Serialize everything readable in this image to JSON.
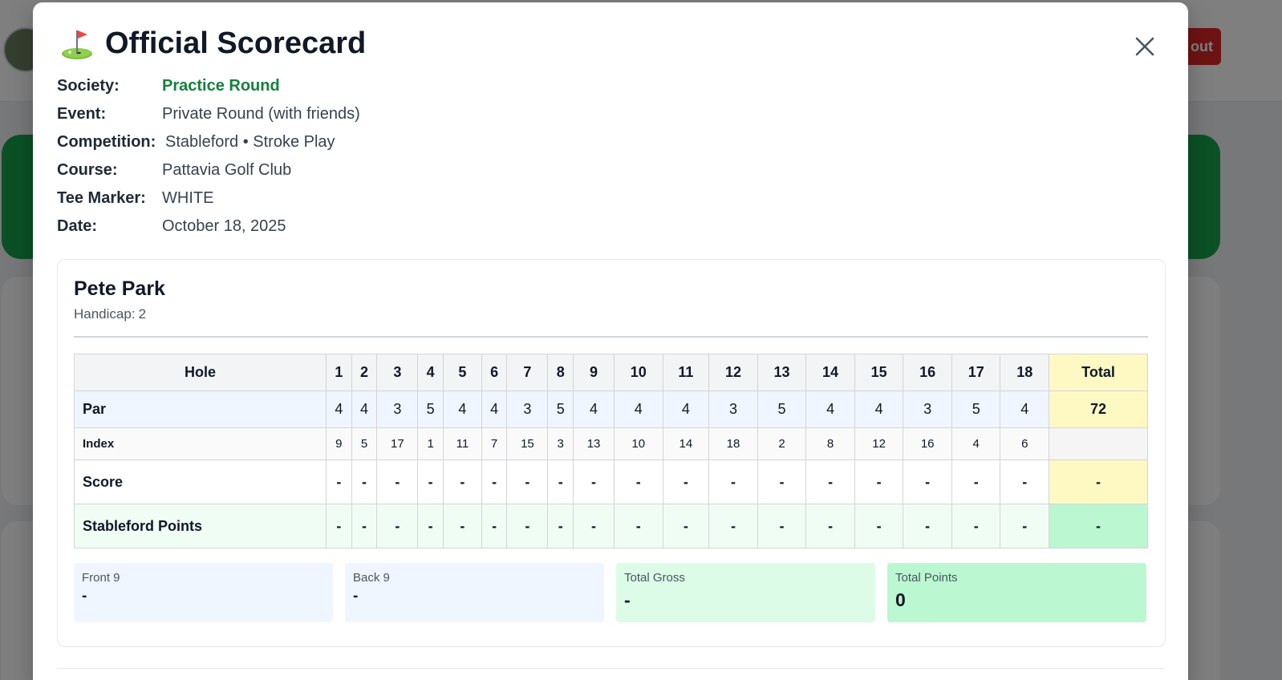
{
  "background": {
    "logout_label": "out"
  },
  "modal": {
    "title": "Official Scorecard",
    "icon": "golf-flag-icon"
  },
  "meta": {
    "society_label": "Society:",
    "society": "Practice Round",
    "event_label": "Event:",
    "event": "Private Round (with friends)",
    "competition_label": "Competition:",
    "competition": "Stableford • Stroke Play",
    "course_label": "Course:",
    "course": "Pattavia Golf Club",
    "tee_label": "Tee Marker:",
    "tee": "WHITE",
    "date_label": "Date:",
    "date": "October 18, 2025"
  },
  "player": {
    "name": "Pete Park",
    "handicap_label": "Handicap:",
    "handicap": "2"
  },
  "table": {
    "hole_header": "Hole",
    "total_header": "Total",
    "holes": [
      "1",
      "2",
      "3",
      "4",
      "5",
      "6",
      "7",
      "8",
      "9",
      "10",
      "11",
      "12",
      "13",
      "14",
      "15",
      "16",
      "17",
      "18"
    ],
    "rows": {
      "par": {
        "label": "Par",
        "values": [
          "4",
          "4",
          "3",
          "5",
          "4",
          "4",
          "3",
          "5",
          "4",
          "4",
          "4",
          "3",
          "5",
          "4",
          "4",
          "3",
          "5",
          "4"
        ],
        "total": "72"
      },
      "index": {
        "label": "Index",
        "values": [
          "9",
          "5",
          "17",
          "1",
          "11",
          "7",
          "15",
          "3",
          "13",
          "10",
          "14",
          "18",
          "2",
          "8",
          "12",
          "16",
          "4",
          "6"
        ],
        "total": ""
      },
      "score": {
        "label": "Score",
        "values": [
          "-",
          "-",
          "-",
          "-",
          "-",
          "-",
          "-",
          "-",
          "-",
          "-",
          "-",
          "-",
          "-",
          "-",
          "-",
          "-",
          "-",
          "-"
        ],
        "total": "-"
      },
      "points": {
        "label": "Stableford Points",
        "values": [
          "-",
          "-",
          "-",
          "-",
          "-",
          "-",
          "-",
          "-",
          "-",
          "-",
          "-",
          "-",
          "-",
          "-",
          "-",
          "-",
          "-",
          "-"
        ],
        "total": "-"
      }
    }
  },
  "summary": {
    "front9_label": "Front 9",
    "front9": "-",
    "back9_label": "Back 9",
    "back9": "-",
    "gross_label": "Total Gross",
    "gross": "-",
    "points_label": "Total Points",
    "points": "0"
  }
}
